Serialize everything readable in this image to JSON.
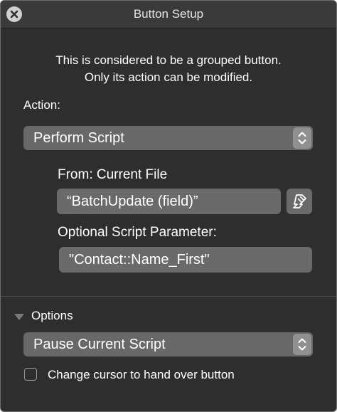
{
  "window": {
    "title": "Button Setup",
    "close_icon": "close-icon"
  },
  "message": {
    "line1": "This is considered to be a grouped button.",
    "line2": "Only its action can be modified."
  },
  "action": {
    "label": "Action:",
    "selected": "Perform Script",
    "stepper_icon": "up-down-chevron-icon"
  },
  "script": {
    "from_label": "From: Current File",
    "name": "“BatchUpdate (field)”",
    "edit_icon": "script-edit-icon",
    "parameter_label": "Optional Script Parameter:",
    "parameter_value": "\"Contact::Name_First\""
  },
  "options": {
    "header": "Options",
    "expanded": true,
    "disclosure_icon": "disclosure-triangle-down-icon",
    "script_state": "Pause Current Script",
    "checkbox_label": "Change cursor to hand over button",
    "checkbox_checked": false
  },
  "colors": {
    "background": "#2e2e2e",
    "control": "#686868",
    "text": "#ffffff"
  }
}
